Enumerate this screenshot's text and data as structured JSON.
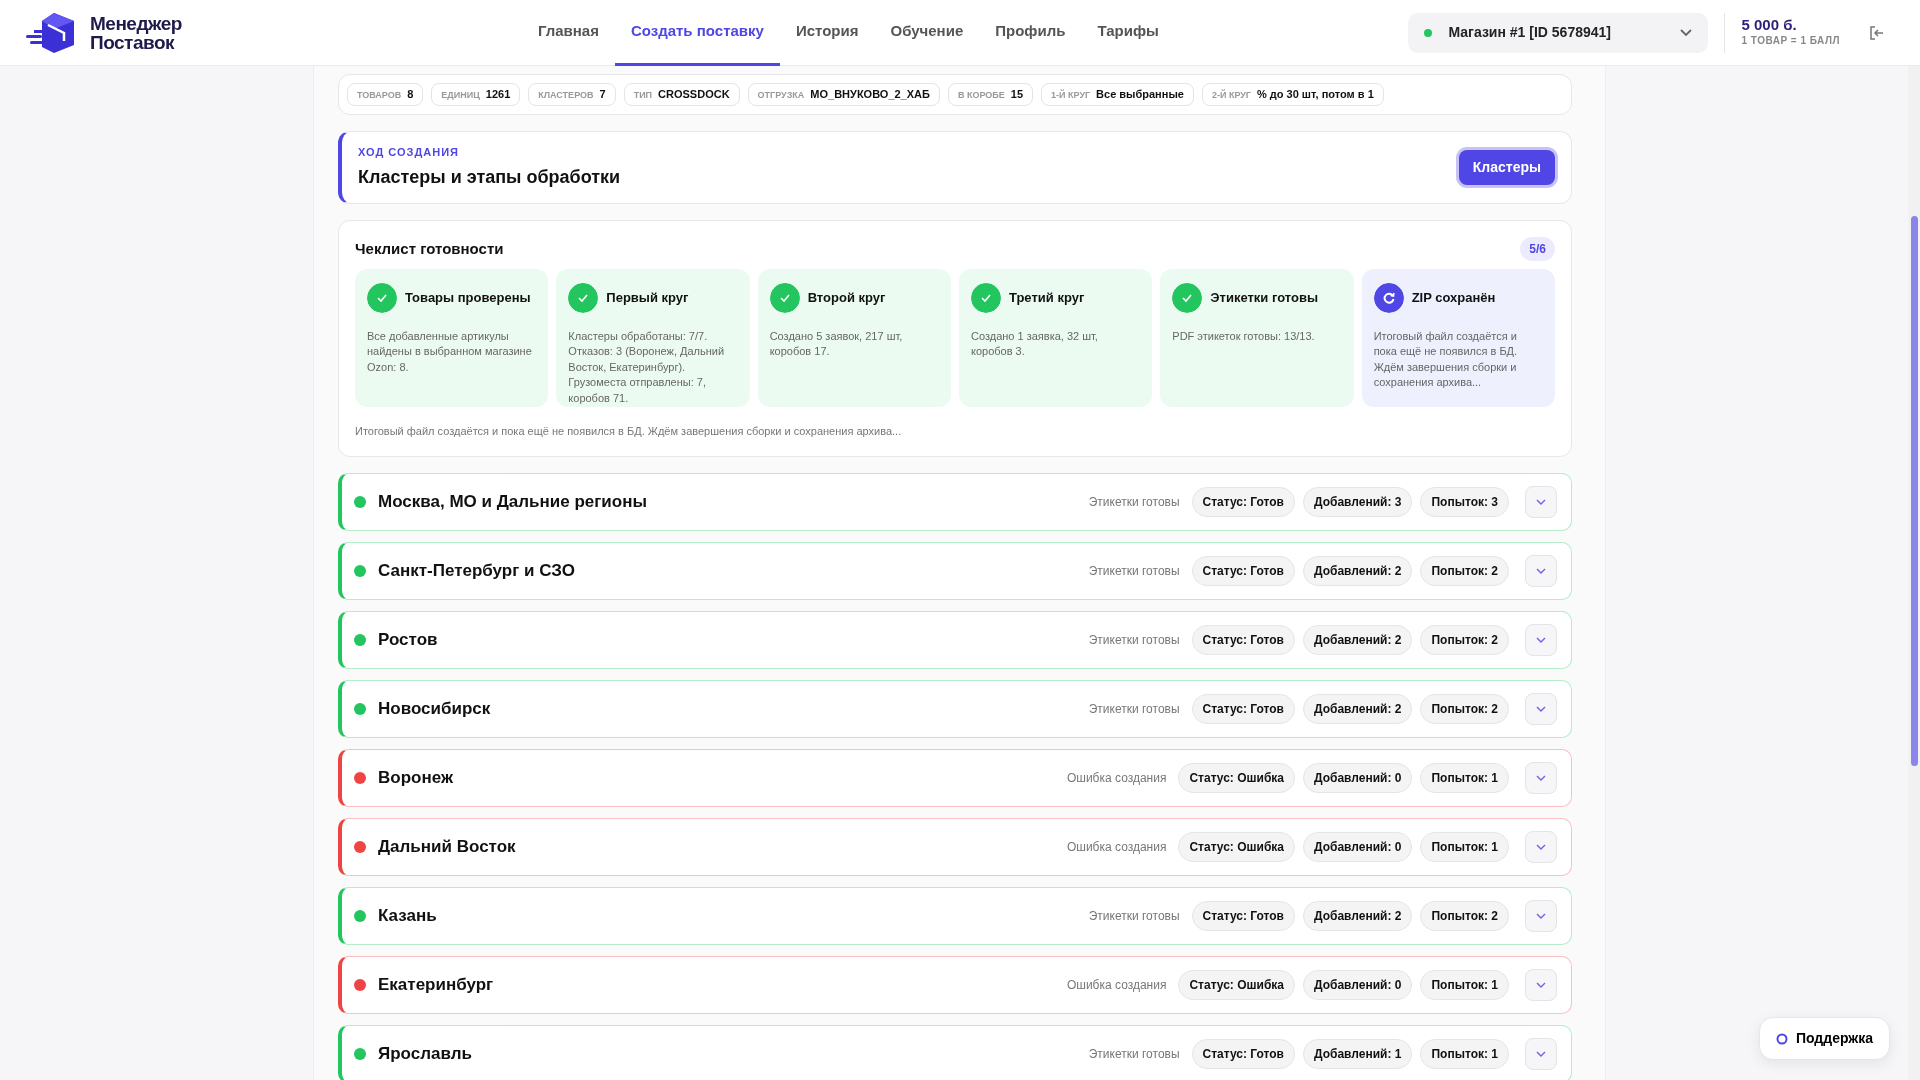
{
  "header": {
    "logo": [
      "Менеджер",
      "Поставок"
    ],
    "nav": [
      {
        "label": "Главная",
        "selected": false
      },
      {
        "label": "Создать поставку",
        "selected": true
      },
      {
        "label": "История",
        "selected": false
      },
      {
        "label": "Обучение",
        "selected": false
      },
      {
        "label": "Профиль",
        "selected": false
      },
      {
        "label": "Тарифы",
        "selected": false
      }
    ],
    "store": {
      "label": "Магазин #1 [ID 5678941]",
      "color": "#22c55e"
    },
    "balance": {
      "amount": "5 000 б.",
      "note": "1 ТОВАР = 1 БАЛЛ"
    }
  },
  "summary_chips": [
    {
      "label": "ТОВАРОВ",
      "value": "8"
    },
    {
      "label": "ЕДИНИЦ",
      "value": "1261"
    },
    {
      "label": "КЛАСТЕРОВ",
      "value": "7"
    },
    {
      "label": "ТИП",
      "value": "CROSSDOCK"
    },
    {
      "label": "ОТГРУЗКА",
      "value": "MO_ВНУКОВО_2_ХАБ"
    },
    {
      "label": "В КОРОБЕ",
      "value": "15"
    },
    {
      "label": "1-Й КРУГ",
      "value": "Все выбранные"
    },
    {
      "label": "2-Й КРУГ",
      "value": "% до 30 шт, потом в 1"
    }
  ],
  "progress": {
    "eyebrow": "ХОД СОЗДАНИЯ",
    "title": "Кластеры и этапы обработки",
    "button": "Кластеры"
  },
  "checklist": {
    "title": "Чеклист готовности",
    "count": "5/6",
    "items": [
      {
        "title": "Товары проверены",
        "text": "Все добавленные артикулы найдены в выбранном магазине Ozon: 8.",
        "done": true
      },
      {
        "title": "Первый круг",
        "text": "Кластеры обработаны: 7/7. Отказов: 3 (Воронеж, Дальний Восток, Екатеринбург). Грузоместа отправлены: 7, коробов 71.",
        "done": true
      },
      {
        "title": "Второй круг",
        "text": "Создано 5 заявок, 217 шт, коробов 17.",
        "done": true
      },
      {
        "title": "Третий круг",
        "text": "Создано 1 заявка, 32 шт, коробов 3.",
        "done": true
      },
      {
        "title": "Этикетки готовы",
        "text": "PDF этикеток готовы: 13/13.",
        "done": true
      },
      {
        "title": "ZIP сохранён",
        "text": "Итоговый файл создаётся и пока ещё не появился в БД. Ждём завершения сборки и сохранения архива...",
        "done": false
      }
    ],
    "footnote": "Итоговый файл создаётся и пока ещё не появился в БД. Ждём завершения сборки и сохранения архива..."
  },
  "clusters": [
    {
      "name": "Москва, МО и Дальние регионы",
      "color": "#22c55e",
      "state": "Этикетки готовы",
      "status": "Статус: Готов",
      "added": "Добавлений: 3",
      "attempts": "Попыток: 3"
    },
    {
      "name": "Санкт-Петербург и СЗО",
      "color": "#22c55e",
      "state": "Этикетки готовы",
      "status": "Статус: Готов",
      "added": "Добавлений: 2",
      "attempts": "Попыток: 2"
    },
    {
      "name": "Ростов",
      "color": "#22c55e",
      "state": "Этикетки готовы",
      "status": "Статус: Готов",
      "added": "Добавлений: 2",
      "attempts": "Попыток: 2"
    },
    {
      "name": "Новосибирск",
      "color": "#22c55e",
      "state": "Этикетки готовы",
      "status": "Статус: Готов",
      "added": "Добавлений: 2",
      "attempts": "Попыток: 2"
    },
    {
      "name": "Воронеж",
      "color": "#ef4444",
      "state": "Ошибка создания",
      "status": "Статус: Ошибка",
      "added": "Добавлений: 0",
      "attempts": "Попыток: 1"
    },
    {
      "name": "Дальний Восток",
      "color": "#ef4444",
      "state": "Ошибка создания",
      "status": "Статус: Ошибка",
      "added": "Добавлений: 0",
      "attempts": "Попыток: 1"
    },
    {
      "name": "Казань",
      "color": "#22c55e",
      "state": "Этикетки готовы",
      "status": "Статус: Готов",
      "added": "Добавлений: 2",
      "attempts": "Попыток: 2"
    },
    {
      "name": "Екатеринбург",
      "color": "#ef4444",
      "state": "Ошибка создания",
      "status": "Статус: Ошибка",
      "added": "Добавлений: 0",
      "attempts": "Попыток: 1"
    },
    {
      "name": "Ярославль",
      "color": "#22c55e",
      "state": "Этикетки готовы",
      "status": "Статус: Готов",
      "added": "Добавлений: 1",
      "attempts": "Попыток: 1"
    }
  ],
  "support": {
    "label": "Поддержка"
  }
}
